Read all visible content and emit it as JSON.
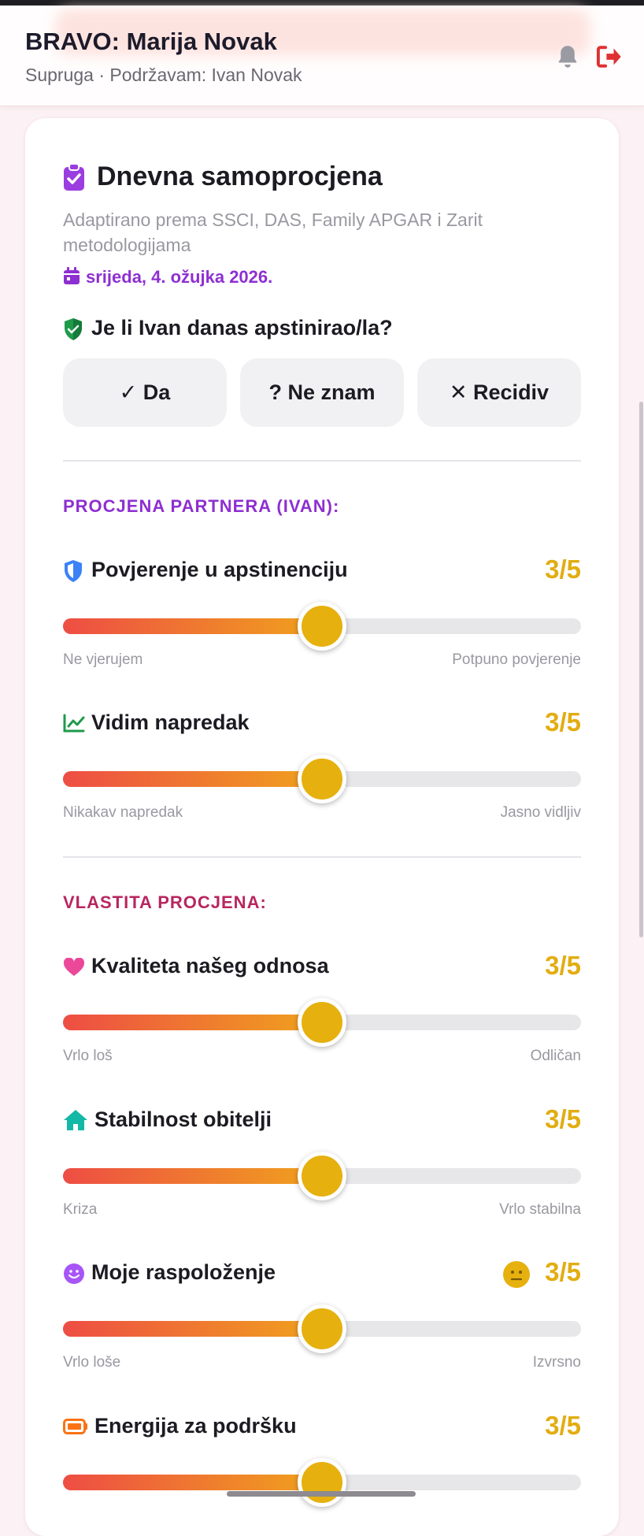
{
  "header": {
    "title": "BRAVO: Marija Novak",
    "subtitle": "Supruga · Podržavam: Ivan Novak"
  },
  "card": {
    "title": "Dnevna samoprocjena",
    "description": "Adaptirano prema SSCI, DAS, Family APGAR i Zarit metodologijama",
    "date": "srijeda, 4. ožujka 2026."
  },
  "abstinence": {
    "question": "Je li Ivan danas apstinirao/la?",
    "options": [
      "✓ Da",
      "? Ne znam",
      "✕ Recidiv"
    ]
  },
  "sections": {
    "partner": "PROCJENA PARTNERA (IVAN):",
    "self": "VLASTITA PROCJENA:"
  },
  "items": [
    {
      "label": "Povjerenje u apstinenciju",
      "score": "3/5",
      "value": 3,
      "max": 5,
      "low": "Ne vjerujem",
      "high": "Potpuno povjerenje",
      "icon": "shield-icon"
    },
    {
      "label": "Vidim napredak",
      "score": "3/5",
      "value": 3,
      "max": 5,
      "low": "Nikakav napredak",
      "high": "Jasno vidljiv",
      "icon": "trend-chart-icon"
    },
    {
      "label": "Kvaliteta našeg odnosa",
      "score": "3/5",
      "value": 3,
      "max": 5,
      "low": "Vrlo loš",
      "high": "Odličan",
      "icon": "heart-icon"
    },
    {
      "label": "Stabilnost obitelji",
      "score": "3/5",
      "value": 3,
      "max": 5,
      "low": "Kriza",
      "high": "Vrlo stabilna",
      "icon": "home-icon"
    },
    {
      "label": "Moje raspoloženje",
      "score": "3/5",
      "value": 3,
      "max": 5,
      "low": "Vrlo loše",
      "high": "Izvrsno",
      "icon": "smiley-icon"
    },
    {
      "label": "Energija za podršku",
      "score": "3/5",
      "value": 3,
      "max": 5,
      "icon": "battery-icon"
    }
  ],
  "colors": {
    "accent_purple": "#8e2fd1",
    "self_section": "#b8265f",
    "score": "#e2ad12",
    "danger": "#e03131"
  }
}
